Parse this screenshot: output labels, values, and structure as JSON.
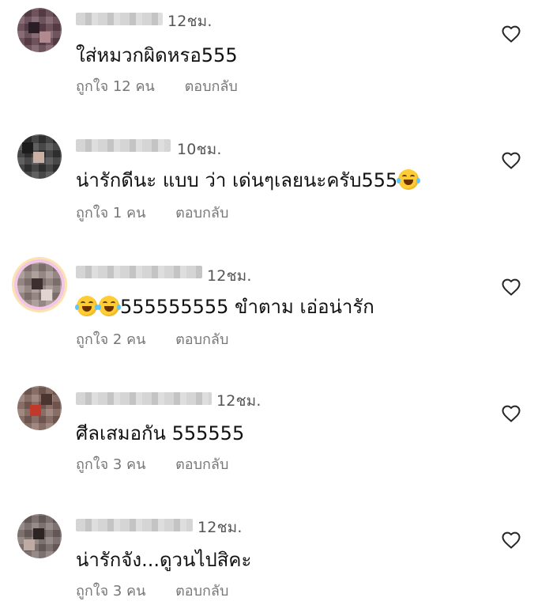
{
  "comments": [
    {
      "time": "12ชม.",
      "text": "ใส่หมวกผิดหรอ555",
      "likes": "ถูกใจ 12 คน",
      "reply": "ตอบกลับ"
    },
    {
      "time": "10ชม.",
      "text": "น่ารักดีนะ แบบ ว่า เด่นๆเลยนะครับ555",
      "emoji_after": "face-with-tears-of-joy-icon",
      "likes": "ถูกใจ 1 คน",
      "reply": "ตอบกลับ"
    },
    {
      "time": "12ชม.",
      "emoji_before": "face-with-tears-of-joy-icon",
      "text": "555555555 ขำตาม เอ่อน่ารัก",
      "likes": "ถูกใจ 2 คน",
      "reply": "ตอบกลับ"
    },
    {
      "time": "12ชม.",
      "text": "ศีลเสมอกัน 555555",
      "likes": "ถูกใจ 3 คน",
      "reply": "ตอบกลับ"
    },
    {
      "time": "12ชม.",
      "text": "น่ารักจัง...ดูวนไปสิคะ",
      "likes": "ถูกใจ 3 คน",
      "reply": "ตอบกลับ"
    }
  ],
  "colors": {
    "text": "#111111",
    "meta": "#777777",
    "time": "#555555",
    "heart_stroke": "#262626",
    "emoji": "#ffcc33"
  }
}
